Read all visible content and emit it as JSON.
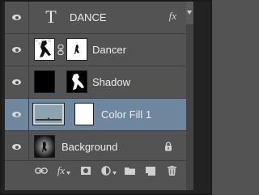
{
  "layers": [
    {
      "name": "DANCE",
      "kind": "text",
      "visible": true,
      "effects_label": "fx"
    },
    {
      "name": "Dancer",
      "kind": "masked-image",
      "visible": true
    },
    {
      "name": "Shadow",
      "kind": "masked-image",
      "visible": true
    },
    {
      "name": "Color Fill 1",
      "kind": "fill",
      "visible": true,
      "selected": true
    },
    {
      "name": "Background",
      "kind": "background",
      "visible": true,
      "locked": true
    }
  ],
  "toolbar": {
    "effects_label": "fx",
    "tools": [
      "link-layers",
      "add-style",
      "add-mask",
      "adjustment",
      "new-group",
      "new-layer",
      "delete"
    ]
  },
  "colors": {
    "panel_bg": "#535353",
    "selected_bg": "#6e869e",
    "text": "#ececec",
    "fill_swatch": "#8da3b0"
  }
}
